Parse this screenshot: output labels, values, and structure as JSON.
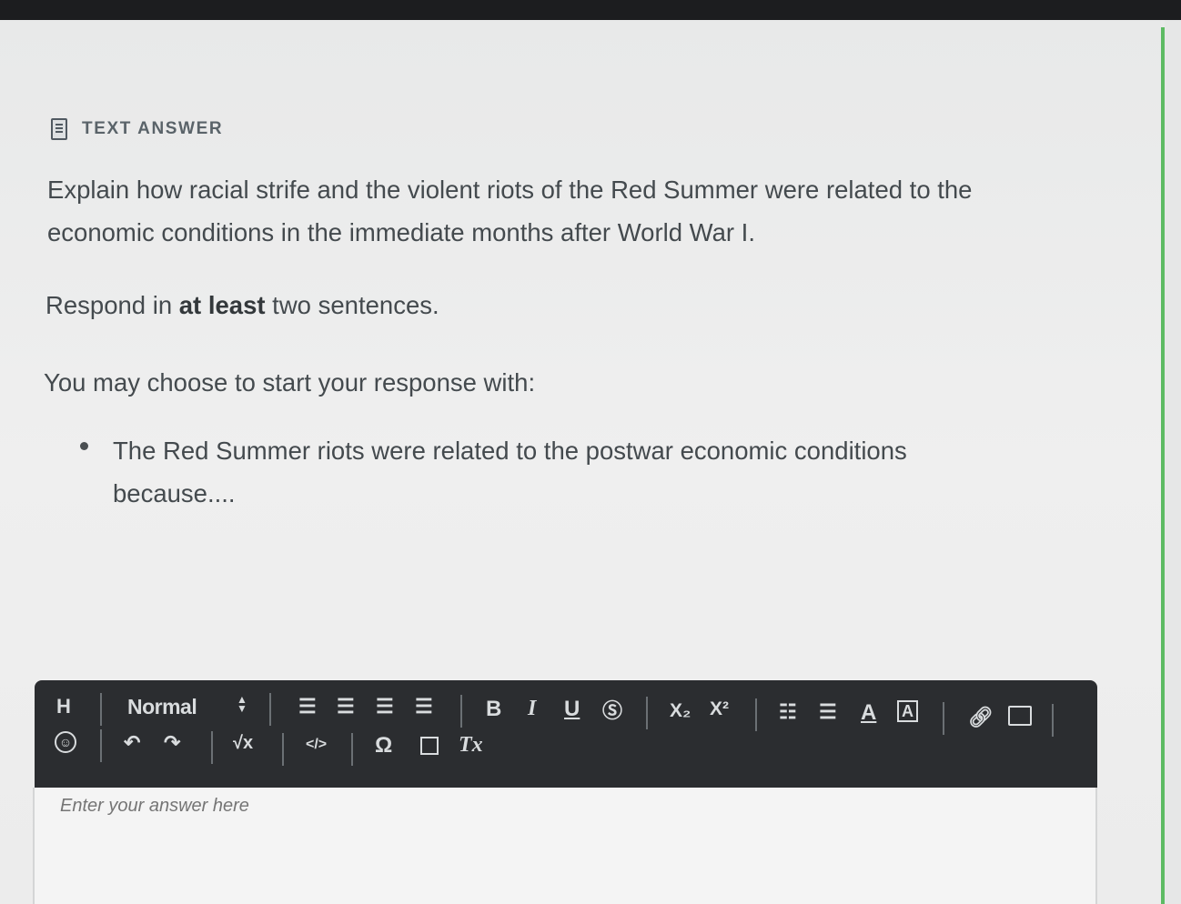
{
  "header": {
    "label": "TEXT ANSWER",
    "icon": "document-icon"
  },
  "question": {
    "prompt": "Explain how racial strife and the violent riots of the Red Summer were related to the economic conditions in the immediate months after World War I.",
    "respond_prefix": "Respond in ",
    "respond_bold": "at least",
    "respond_suffix": " two sentences.",
    "starter_intro": "You may choose to start your response with:",
    "starter_bullet": "The Red Summer riots were related to the postwar economic conditions because...."
  },
  "toolbar": {
    "heading_label": "H",
    "format_select": "Normal",
    "bold": "B",
    "italic": "I",
    "underline": "U",
    "subscript": "X₂",
    "superscript": "X²",
    "formula": "√x",
    "code": "</>",
    "special_char": "Ω",
    "clear_format": "Tx",
    "icons": [
      "heading-icon",
      "emoji-icon",
      "undo-icon",
      "redo-icon",
      "align-left-icon",
      "align-center-icon",
      "align-right-icon",
      "align-justify-icon",
      "strikethrough-icon",
      "ordered-list-icon",
      "bullet-list-icon",
      "font-color-icon",
      "highlight-color-icon",
      "link-icon",
      "image-icon",
      "media-icon"
    ]
  },
  "editor": {
    "placeholder": "Enter your answer here"
  },
  "colors": {
    "accent": "#5dbb63",
    "toolbar_bg": "#2b2d30",
    "text": "#444a4e"
  }
}
